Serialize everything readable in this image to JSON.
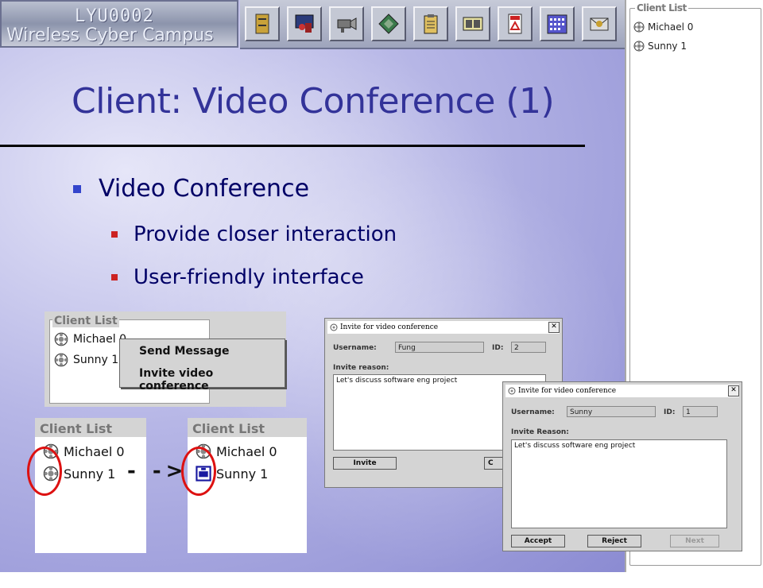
{
  "banner": {
    "line1": "LYU0002",
    "line2": "Wireless Cyber Campus"
  },
  "toolbar_icons": [
    "cabinet-icon",
    "classroom-icon",
    "camera-icon",
    "game-icon",
    "clipboard-icon",
    "news-icon",
    "pdf-icon",
    "calendar-icon",
    "mail-icon"
  ],
  "client_list_panel": {
    "title": "Client List",
    "items": [
      "Michael 0",
      "Sunny 1"
    ]
  },
  "slide": {
    "title": "Client: Video Conference (1)",
    "bullet": "Video Conference",
    "sub_bullets": [
      "Provide closer interaction",
      "User-friendly interface"
    ]
  },
  "context_shot": {
    "title": "Client List",
    "items": [
      "Michael 0",
      "Sunny 1"
    ],
    "menu": [
      "Send Message",
      "Invite video conference"
    ]
  },
  "before_shot": {
    "title": "Client List",
    "items": [
      "Michael 0",
      "Sunny 1"
    ]
  },
  "after_shot": {
    "title": "Client List",
    "items": [
      "Michael 0",
      "Sunny 1"
    ]
  },
  "arrow_text": "- ->",
  "invite_dialog": {
    "title": "Invite for video conference",
    "username_label": "Username:",
    "username": "Fung",
    "id_label": "ID:",
    "id": "2",
    "reason_label": "Invite reason:",
    "reason": "Let's discuss software eng project",
    "invite_button": "Invite",
    "cancel_button_partial": "C"
  },
  "accept_dialog": {
    "title": "Invite for video conference",
    "username_label": "Username:",
    "username": "Sunny",
    "id_label": "ID:",
    "id": "1",
    "reason_label": "Invite Reason:",
    "reason": "Let's discuss software eng project",
    "accept_button": "Accept",
    "reject_button": "Reject",
    "next_button": "Next"
  },
  "colors": {
    "title": "#333399",
    "bullet_blue": "#3344cc",
    "bullet_red": "#cc2222",
    "circle": "#dd1111"
  }
}
